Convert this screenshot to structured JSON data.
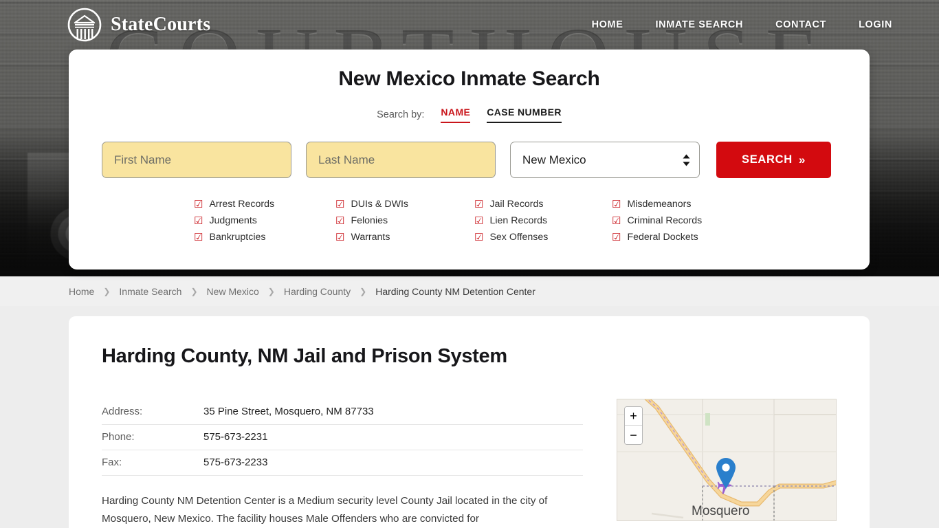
{
  "header": {
    "brand_name": "StateCourts",
    "logo_icon": "courthouse-circle-icon",
    "nav": [
      {
        "label": "HOME",
        "name": "home"
      },
      {
        "label": "INMATE SEARCH",
        "name": "inmate-search"
      },
      {
        "label": "CONTACT",
        "name": "contact"
      },
      {
        "label": "LOGIN",
        "name": "login"
      }
    ]
  },
  "search_card": {
    "title": "New Mexico Inmate Search",
    "search_by_label": "Search by:",
    "tabs": [
      {
        "label": "NAME",
        "active": true
      },
      {
        "label": "CASE NUMBER",
        "active": false
      }
    ],
    "first_name_placeholder": "First Name",
    "first_name_value": "",
    "last_name_placeholder": "Last Name",
    "last_name_value": "",
    "state_selected": "New Mexico",
    "state_options": [
      "New Mexico"
    ],
    "search_button_label": "SEARCH",
    "search_button_chevron": "»",
    "checkbox_glyph": "☑",
    "features": [
      "Arrest Records",
      "DUIs & DWIs",
      "Jail Records",
      "Misdemeanors",
      "Judgments",
      "Felonies",
      "Lien Records",
      "Criminal Records",
      "Bankruptcies",
      "Warrants",
      "Sex Offenses",
      "Federal Dockets"
    ],
    "accent_red": "#c9151b",
    "button_red": "#d30a0f",
    "input_yellow": "#f9e49f"
  },
  "breadcrumb": {
    "separator": "›",
    "items": [
      {
        "label": "Home",
        "current": false
      },
      {
        "label": "Inmate Search",
        "current": false
      },
      {
        "label": "New Mexico",
        "current": false
      },
      {
        "label": "Harding County",
        "current": false
      },
      {
        "label": "Harding County NM Detention Center",
        "current": true
      }
    ]
  },
  "content": {
    "page_title": "Harding County, NM Jail and Prison System",
    "info_rows": [
      {
        "label": "Address:",
        "value": "35 Pine Street, Mosquero, NM 87733"
      },
      {
        "label": "Phone:",
        "value": "575-673-2231"
      },
      {
        "label": "Fax:",
        "value": "575-673-2233"
      }
    ],
    "description": "Harding County NM Detention Center is a Medium security level County Jail located in the city of Mosquero, New Mexico. The facility houses Male Offenders who are convicted for"
  },
  "map": {
    "zoom_in_label": "+",
    "zoom_out_label": "−",
    "place_label": "Mosquero",
    "marker_icon": "map-pin-marker",
    "airport_icon": "airplane-icon",
    "background_color": "#f2efe9",
    "road_color": "#f2c98a",
    "marker_color": "#2a7fcc"
  }
}
